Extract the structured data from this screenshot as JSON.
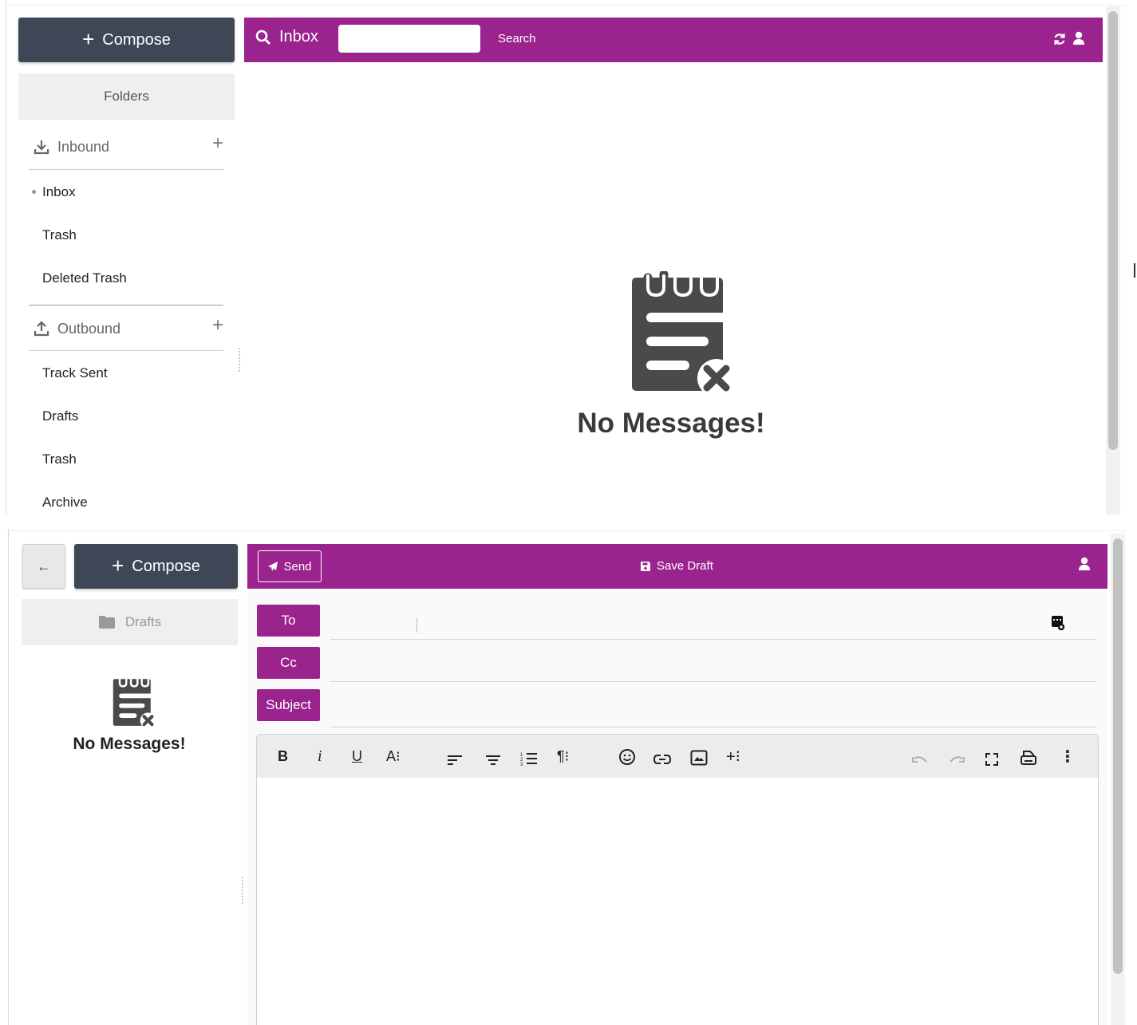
{
  "inbox_view": {
    "compose_label": "Compose",
    "folders_header": "Folders",
    "search_title": "Inbox",
    "search_placeholder": "",
    "search_button": "Search",
    "groups": {
      "inbound": {
        "label": "Inbound",
        "items": [
          "Inbox",
          "Trash",
          "Deleted Trash"
        ]
      },
      "outbound": {
        "label": "Outbound",
        "items": [
          "Track Sent",
          "Drafts",
          "Trash",
          "Archive"
        ]
      }
    },
    "empty_message": "No Messages!",
    "selected_folder": "Inbox"
  },
  "compose_view": {
    "compose_label": "Compose",
    "back_icon": "arrow-left-icon",
    "send_label": "Send",
    "save_draft_label": "Save Draft",
    "folder_label": "Drafts",
    "empty_message": "No Messages!",
    "fields": {
      "to_label": "To",
      "cc_label": "Cc",
      "subject_label": "Subject",
      "to_value": "",
      "cc_value": "",
      "subject_value": ""
    },
    "toolbar": {
      "bold": "B",
      "italic": "i",
      "underline": "U",
      "font_size": "A⁝",
      "paragraph": "¶⁝",
      "insert_more": "+⁝",
      "more": "⋮"
    },
    "editor_body": ""
  },
  "colors": {
    "accent": "#9b238e",
    "compose_button": "#3f4756",
    "sidebar_header_bg": "#efefef",
    "empty_icon": "#4a4a4a"
  }
}
